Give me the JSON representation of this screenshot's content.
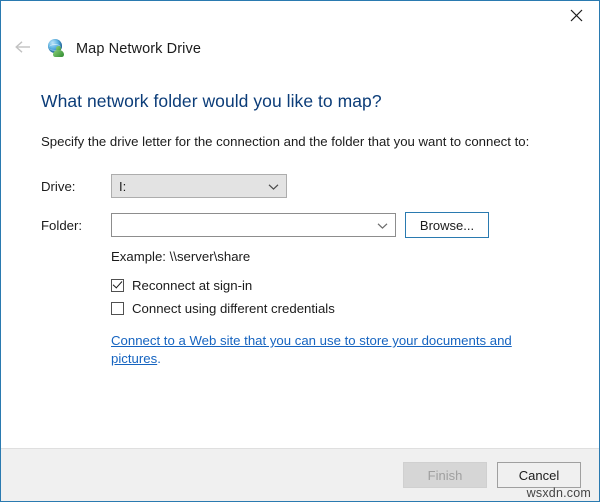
{
  "window": {
    "title": "Map Network Drive",
    "app_icon": "network-drive-globe-icon",
    "close_label": "✕",
    "back_label": "back-arrow",
    "border_color": "#2a7ab0"
  },
  "content": {
    "heading": "What network folder would you like to map?",
    "heading_color": "#0b3c78",
    "subtext": "Specify the drive letter for the connection and the folder that you want to connect to:",
    "drive": {
      "label": "Drive:",
      "value": "I:",
      "placeholder": "",
      "chevron_icon": "chevron-down-icon"
    },
    "folder": {
      "label": "Folder:",
      "value": "",
      "placeholder": "",
      "chevron_icon": "chevron-down-icon"
    },
    "browse_button": "Browse...",
    "example": "Example: \\\\server\\share",
    "checkboxes": [
      {
        "label": "Reconnect at sign-in",
        "checked": true
      },
      {
        "label": "Connect using different credentials",
        "checked": false
      }
    ],
    "web_link": {
      "text": "Connect to a Web site that you can use to store your documents and pictures",
      "trailing": ".",
      "color": "#1664c0"
    }
  },
  "footer": {
    "finish_label": "Finish",
    "finish_enabled": false,
    "cancel_label": "Cancel",
    "cancel_enabled": true
  },
  "watermark": "wsxdn.com"
}
